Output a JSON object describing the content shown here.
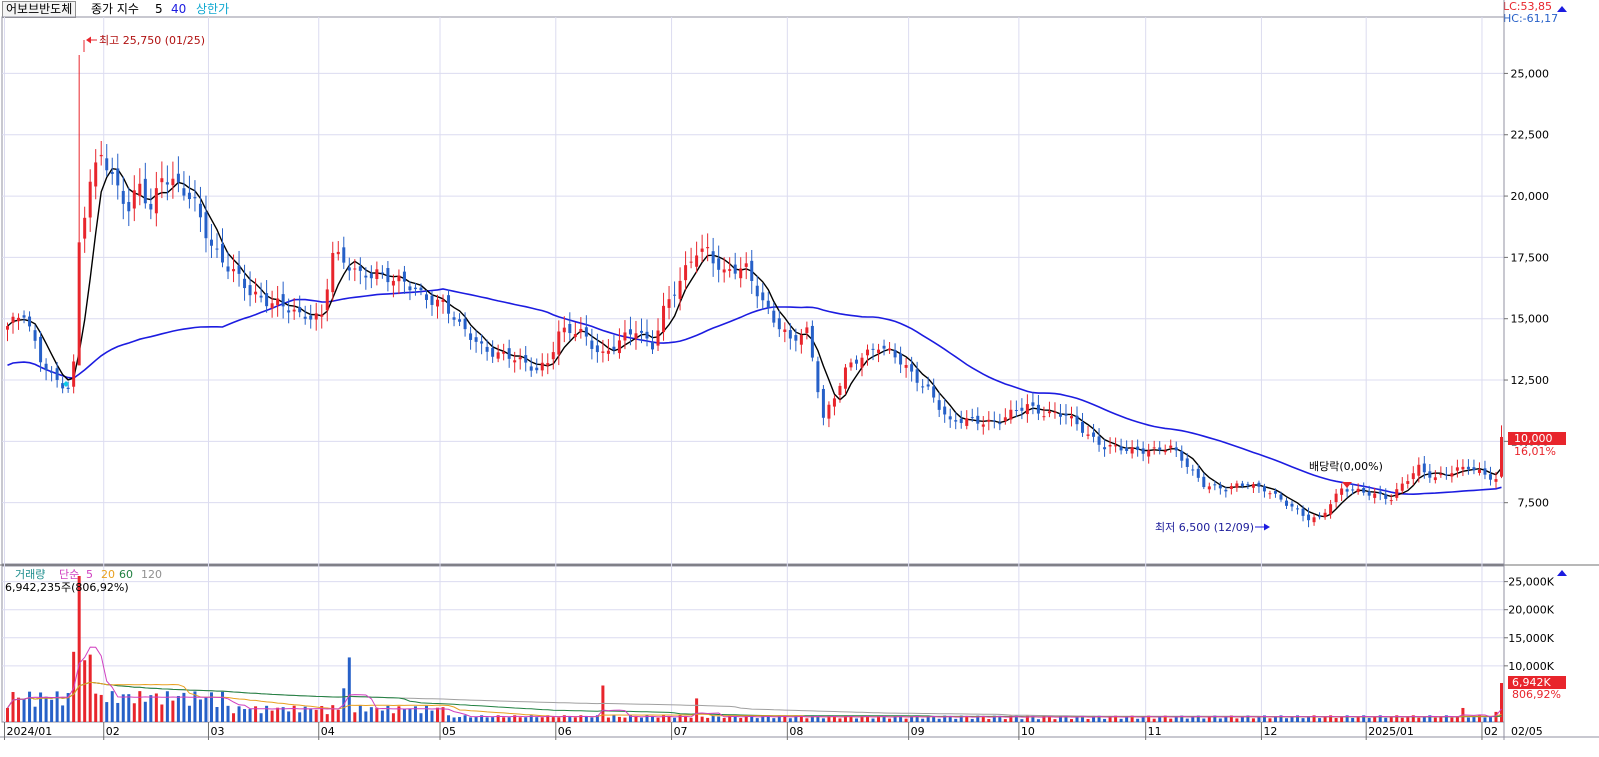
{
  "header": {
    "stock_name": "어보브반도체",
    "price_label": "종가 지수",
    "ma_short": "5",
    "ma_long": "40",
    "limit_label": "상한가",
    "lc": "LC:53,85",
    "hc": "HC:-61,17"
  },
  "annotations": {
    "high": "최고 25,750 (01/25)",
    "low": "최저 6,500 (12/09)",
    "dividend": "배당락(0,00%)"
  },
  "current": {
    "price_tag": "10,000",
    "change_pct": "16,01%",
    "volume_tag": "6,942K",
    "volume_pct": "806,92%"
  },
  "volume_header": {
    "title": "거래량",
    "ma_label": "단순",
    "p5": "5",
    "p20": "20",
    "p60": "60",
    "p120": "120",
    "readout": "6,942,235주(806,92%)"
  },
  "colors": {
    "up": "#e8252c",
    "down": "#2660c8",
    "ma5": "#000000",
    "ma40": "#1c1ce0",
    "vol_ma5": "#d040c0",
    "vol_ma20": "#e8a020",
    "vol_ma60": "#208040",
    "vol_ma120": "#a0a0a0",
    "grid": "#dcdcf0"
  },
  "chart_data": {
    "type": "candlestick",
    "price_axis": {
      "ticks": [
        7500,
        10000,
        12500,
        15000,
        17500,
        20000,
        22500,
        25000
      ],
      "tick_labels": [
        "7,500",
        "10,000",
        "12,500",
        "15,000",
        "17,500",
        "20,000",
        "22,500",
        "25,000"
      ],
      "ylim": [
        5000,
        27300
      ]
    },
    "volume_axis": {
      "ticks": [
        10000,
        15000,
        20000,
        25000
      ],
      "tick_labels": [
        "10,000K",
        "15,000K",
        "20,000K",
        "25,000K"
      ],
      "ylim": [
        0,
        26000
      ]
    },
    "months": [
      "2024/01",
      "02",
      "03",
      "04",
      "05",
      "06",
      "07",
      "08",
      "09",
      "10",
      "11",
      "12",
      "2025/01",
      "02"
    ],
    "last_label": "02/05",
    "month_start_index": [
      0,
      18,
      37,
      57,
      79,
      100,
      121,
      142,
      164,
      184,
      207,
      228,
      247,
      268
    ],
    "price_anchors": [
      [
        0,
        14700
      ],
      [
        3,
        15100
      ],
      [
        6,
        13400
      ],
      [
        9,
        12500
      ],
      [
        11,
        12100
      ],
      [
        12,
        13000
      ],
      [
        13,
        18000
      ],
      [
        15,
        20500
      ],
      [
        17,
        22000
      ],
      [
        19,
        20800
      ],
      [
        22,
        19300
      ],
      [
        24,
        20400
      ],
      [
        26,
        19500
      ],
      [
        28,
        21000
      ],
      [
        31,
        20300
      ],
      [
        34,
        19600
      ],
      [
        37,
        18100
      ],
      [
        40,
        17100
      ],
      [
        44,
        16000
      ],
      [
        49,
        15700
      ],
      [
        53,
        15000
      ],
      [
        57,
        15200
      ],
      [
        59,
        17800
      ],
      [
        61,
        17200
      ],
      [
        64,
        16700
      ],
      [
        67,
        17000
      ],
      [
        70,
        16600
      ],
      [
        75,
        16000
      ],
      [
        79,
        15700
      ],
      [
        82,
        14600
      ],
      [
        86,
        13900
      ],
      [
        90,
        13500
      ],
      [
        94,
        13100
      ],
      [
        96,
        13000
      ],
      [
        98,
        13300
      ],
      [
        100,
        14400
      ],
      [
        104,
        14400
      ],
      [
        108,
        13600
      ],
      [
        111,
        14000
      ],
      [
        114,
        14500
      ],
      [
        117,
        14000
      ],
      [
        119,
        15400
      ],
      [
        122,
        16400
      ],
      [
        125,
        17800
      ],
      [
        127,
        17900
      ],
      [
        130,
        16800
      ],
      [
        134,
        17000
      ],
      [
        136,
        16200
      ],
      [
        139,
        15000
      ],
      [
        142,
        14000
      ],
      [
        145,
        14500
      ],
      [
        146,
        13500
      ],
      [
        148,
        11000
      ],
      [
        150,
        11800
      ],
      [
        152,
        12800
      ],
      [
        155,
        13500
      ],
      [
        158,
        14000
      ],
      [
        161,
        13400
      ],
      [
        164,
        12700
      ],
      [
        167,
        12200
      ],
      [
        171,
        10700
      ],
      [
        175,
        10900
      ],
      [
        180,
        10800
      ],
      [
        183,
        11200
      ],
      [
        185,
        11500
      ],
      [
        188,
        11200
      ],
      [
        192,
        11000
      ],
      [
        195,
        10500
      ],
      [
        199,
        9800
      ],
      [
        203,
        9600
      ],
      [
        207,
        9700
      ],
      [
        211,
        9700
      ],
      [
        214,
        9000
      ],
      [
        217,
        8300
      ],
      [
        221,
        8000
      ],
      [
        225,
        8300
      ],
      [
        228,
        8100
      ],
      [
        232,
        7400
      ],
      [
        236,
        6900
      ],
      [
        238,
        6900
      ],
      [
        242,
        8000
      ],
      [
        246,
        8000
      ],
      [
        249,
        7800
      ],
      [
        251,
        7600
      ],
      [
        253,
        8200
      ],
      [
        256,
        9000
      ],
      [
        259,
        8500
      ],
      [
        262,
        8700
      ],
      [
        265,
        9000
      ],
      [
        268,
        8700
      ],
      [
        270,
        8400
      ],
      [
        271,
        10000
      ]
    ],
    "spikes": [
      [
        13,
        25750,
        17900
      ],
      [
        236,
        7300,
        6500
      ],
      [
        271,
        10650,
        8500
      ]
    ],
    "volume_spikes": [
      [
        13,
        26000
      ],
      [
        12,
        12500
      ],
      [
        15,
        12000
      ],
      [
        14,
        11000
      ],
      [
        62,
        11500
      ],
      [
        61,
        6000
      ],
      [
        59,
        3000
      ],
      [
        108,
        6500
      ],
      [
        125,
        4200
      ],
      [
        271,
        6942
      ],
      [
        270,
        1800
      ],
      [
        264,
        2500
      ]
    ]
  }
}
